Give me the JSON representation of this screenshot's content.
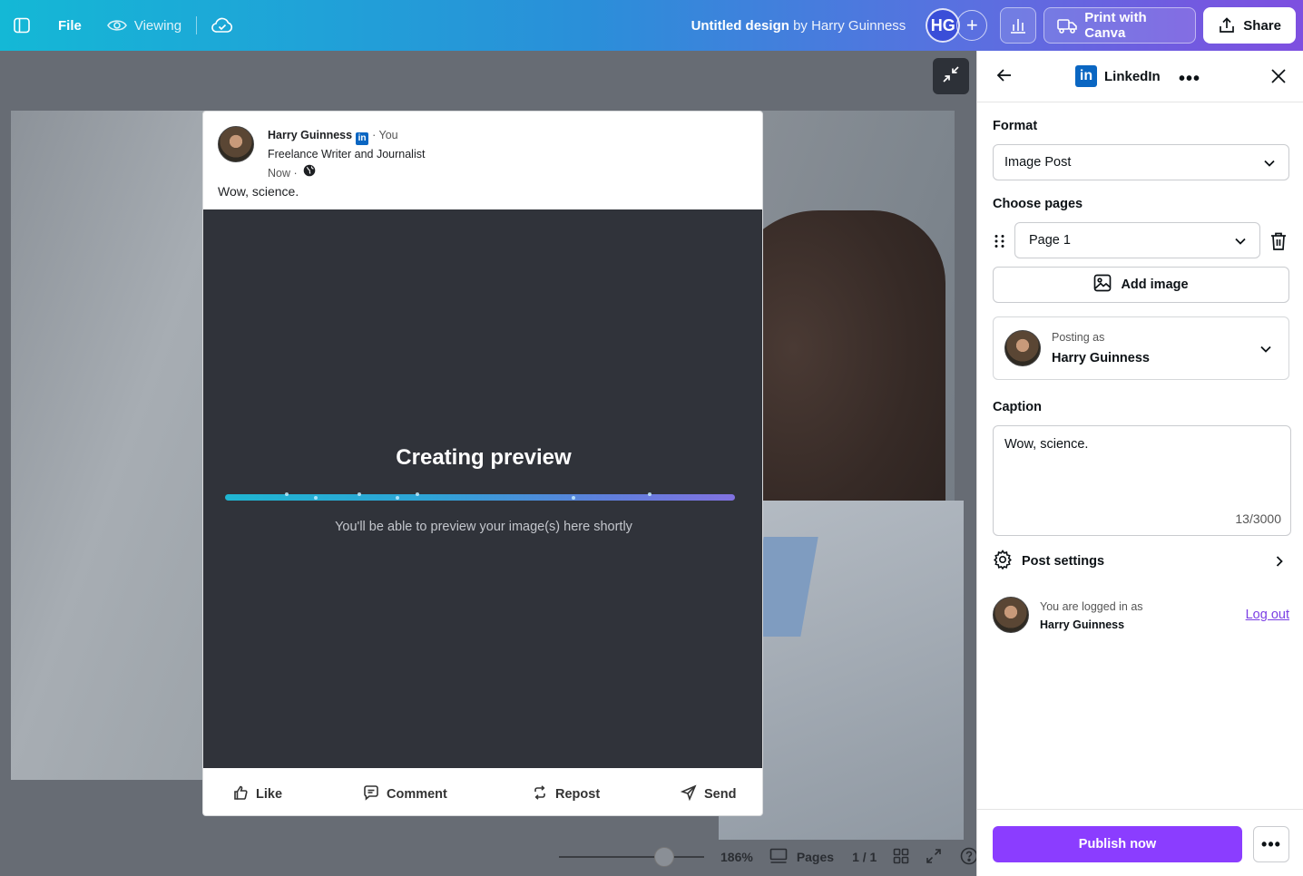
{
  "topbar": {
    "file_label": "File",
    "viewing_label": "Viewing",
    "doc_title": "Untitled design",
    "doc_by": "by Harry Guinness",
    "avatar_initials": "HG",
    "plus": "+",
    "print_label": "Print with Canva",
    "share_label": "Share"
  },
  "preview": {
    "author_name": "Harry Guinness",
    "you_label": "· You",
    "headline": "Freelance Writer and Journalist",
    "time_label": "Now ·",
    "caption": "Wow, science.",
    "loading_title": "Creating preview",
    "loading_sub": "You'll be able to preview your image(s) here shortly",
    "actions": {
      "like": "Like",
      "comment": "Comment",
      "repost": "Repost",
      "send": "Send"
    }
  },
  "status": {
    "zoom": "186%",
    "pages_label": "Pages",
    "page_count": "1 / 1"
  },
  "panel": {
    "title": "LinkedIn",
    "format_label": "Format",
    "format_value": "Image Post",
    "choose_pages_label": "Choose pages",
    "page_value": "Page 1",
    "add_image_label": "Add image",
    "posting_as_label": "Posting as",
    "posting_as_name": "Harry Guinness",
    "caption_label": "Caption",
    "caption_value": "Wow, science.",
    "caption_count": "13/3000",
    "post_settings_label": "Post settings",
    "logged_in_label": "You are logged in as",
    "logged_in_name": "Harry Guinness",
    "logout_label": "Log out",
    "publish_label": "Publish now",
    "more_label": "•••"
  },
  "colors": {
    "accent": "#8b3dff",
    "linkedin": "#0a66c2"
  }
}
